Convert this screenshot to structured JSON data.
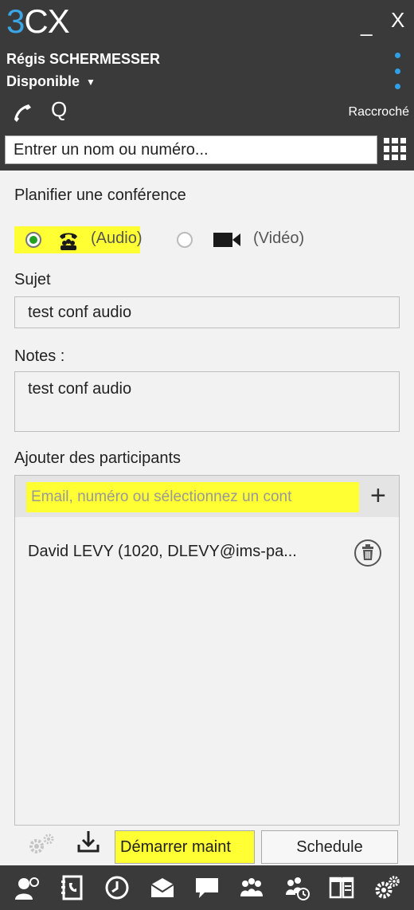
{
  "app": {
    "logo_prefix": "3",
    "logo_suffix": "CX",
    "minimize_glyph": "_",
    "close_glyph": "X"
  },
  "user": {
    "name": "Régis SCHERMESSER",
    "status": "Disponible"
  },
  "header": {
    "hangup_label": "Raccroché",
    "search_glyph": "Q",
    "dial_value": "Entrer un nom ou numéro..."
  },
  "conference": {
    "title": "Planifier une conférence",
    "audio_label": "(Audio)",
    "video_label": "(Vidéo)",
    "selected_mode": "audio",
    "subject_label": "Sujet",
    "subject_value": "test conf audio",
    "notes_label": "Notes :",
    "notes_value": "test conf audio",
    "participants_label": "Ajouter des participants",
    "participants_placeholder": "Email, numéro ou sélectionnez un cont",
    "participants": [
      {
        "name": "David LEVY (1020, DLEVY@ims-pa..."
      }
    ],
    "start_label": "Démarrer maint",
    "schedule_label": "Schedule"
  },
  "toolbar": {
    "icons": [
      "presence-icon",
      "contacts-icon",
      "history-icon",
      "voicemail-icon",
      "chat-icon",
      "conference-icon",
      "scheduled-conference-icon",
      "switchboard-icon",
      "settings-icon"
    ]
  },
  "colors": {
    "header_bg": "#3a3a3a",
    "accent_blue": "#3aa6e6",
    "highlight_yellow": "#ffff33",
    "radio_selected": "#22a022"
  }
}
